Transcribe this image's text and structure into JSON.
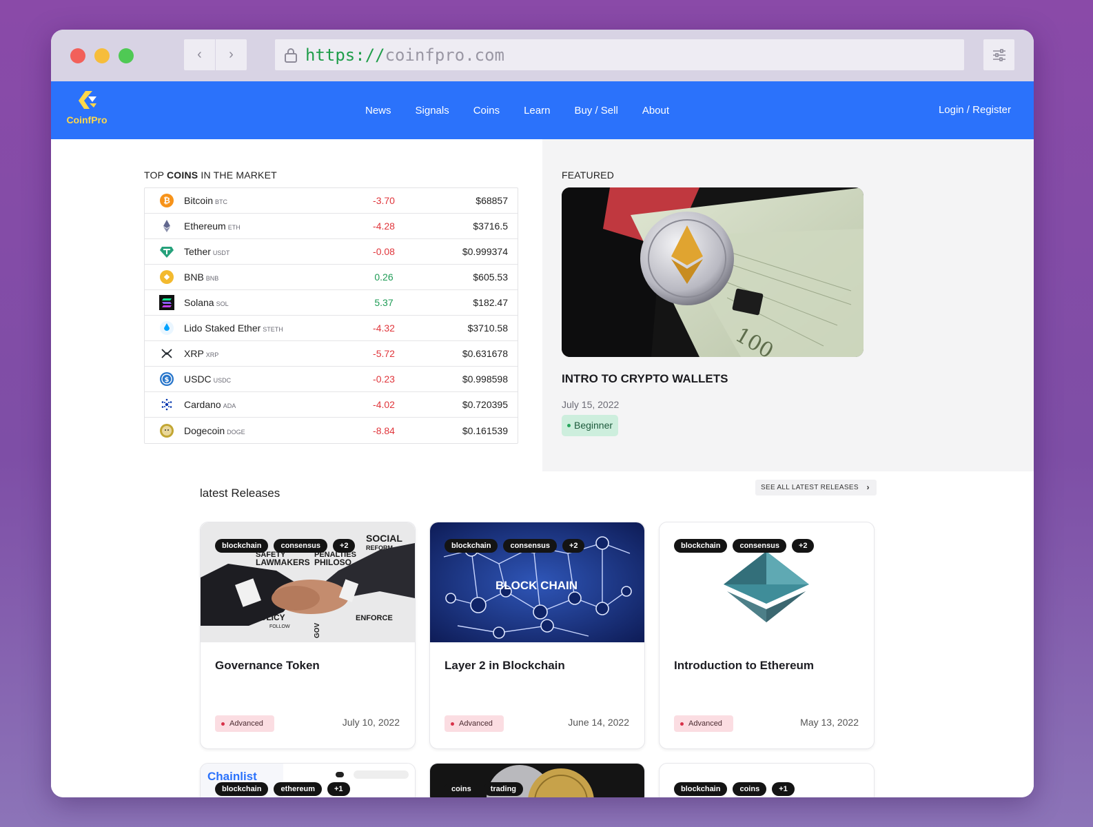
{
  "browser": {
    "url_scheme": "https://",
    "url_host": "coinfpro.com",
    "back_glyph": "‹",
    "forward_glyph": "›"
  },
  "site": {
    "logo_text": "CoinfPro",
    "nav": [
      "News",
      "Signals",
      "Coins",
      "Learn",
      "Buy / Sell",
      "About"
    ],
    "login": "Login / Register"
  },
  "top_coins": {
    "label_prefix": "TOP ",
    "label_bold": "COINS",
    "label_suffix": " IN THE MARKET",
    "rows": [
      {
        "name": "Bitcoin",
        "symbol": "BTC",
        "change": "-3.70",
        "price": "$68857",
        "icon": "bitcoin-icon",
        "color": "#f7931a"
      },
      {
        "name": "Ethereum",
        "symbol": "ETH",
        "change": "-4.28",
        "price": "$3716.5",
        "icon": "ethereum-icon",
        "color": "#62688f"
      },
      {
        "name": "Tether",
        "symbol": "USDT",
        "change": "-0.08",
        "price": "$0.999374",
        "icon": "tether-icon",
        "color": "#26a17b"
      },
      {
        "name": "BNB",
        "symbol": "BNB",
        "change": "0.26",
        "price": "$605.53",
        "icon": "bnb-icon",
        "color": "#f3ba2f"
      },
      {
        "name": "Solana",
        "symbol": "SOL",
        "change": "5.37",
        "price": "$182.47",
        "icon": "solana-icon",
        "color": "#14f195"
      },
      {
        "name": "Lido Staked Ether",
        "symbol": "STETH",
        "change": "-4.32",
        "price": "$3710.58",
        "icon": "lido-icon",
        "color": "#00a3ff"
      },
      {
        "name": "XRP",
        "symbol": "XRP",
        "change": "-5.72",
        "price": "$0.631678",
        "icon": "xrp-icon",
        "color": "#23292f"
      },
      {
        "name": "USDC",
        "symbol": "USDC",
        "change": "-0.23",
        "price": "$0.998598",
        "icon": "usdc-icon",
        "color": "#2775ca"
      },
      {
        "name": "Cardano",
        "symbol": "ADA",
        "change": "-4.02",
        "price": "$0.720395",
        "icon": "cardano-icon",
        "color": "#0033ad"
      },
      {
        "name": "Dogecoin",
        "symbol": "DOGE",
        "change": "-8.84",
        "price": "$0.161539",
        "icon": "dogecoin-icon",
        "color": "#c2a633"
      }
    ]
  },
  "featured": {
    "label": "FEATURED",
    "title": "INTRO TO CRYPTO WALLETS",
    "date": "July 15, 2022",
    "level": "Beginner"
  },
  "releases": {
    "title": "latest Releases",
    "see_all": "SEE ALL LATEST RELEASES",
    "see_all_glyph": "›",
    "cards": [
      {
        "title": "Governance Token",
        "date": "July 10, 2022",
        "level": "Advanced",
        "tags": [
          "blockchain",
          "consensus",
          "+2"
        ]
      },
      {
        "title": "Layer 2 in Blockchain",
        "date": "June 14, 2022",
        "level": "Advanced",
        "tags": [
          "blockchain",
          "consensus",
          "+2"
        ]
      },
      {
        "title": "Introduction to Ethereum",
        "date": "May 13, 2022",
        "level": "Advanced",
        "tags": [
          "blockchain",
          "consensus",
          "+2"
        ]
      }
    ],
    "partial_cards": [
      {
        "tags": [
          "blockchain",
          "ethereum",
          "+1"
        ],
        "image_text": "Chainlist"
      },
      {
        "tags": [
          "coins",
          "trading"
        ]
      },
      {
        "tags": [
          "blockchain",
          "coins",
          "+1"
        ]
      }
    ],
    "card_image_texts": {
      "governance": [
        "SOCIAL",
        "REFORM",
        "SAFETY",
        "LAWMAKERS",
        "PENALTIES",
        "PHILOSO",
        "POLICY",
        "ENFORCE",
        "FOLLOW",
        "GOV"
      ],
      "layer2": "BLOCK CHAIN"
    }
  },
  "colors": {
    "brand": "#2b72fb",
    "negative": "#e0353b",
    "positive": "#1e9b55"
  }
}
